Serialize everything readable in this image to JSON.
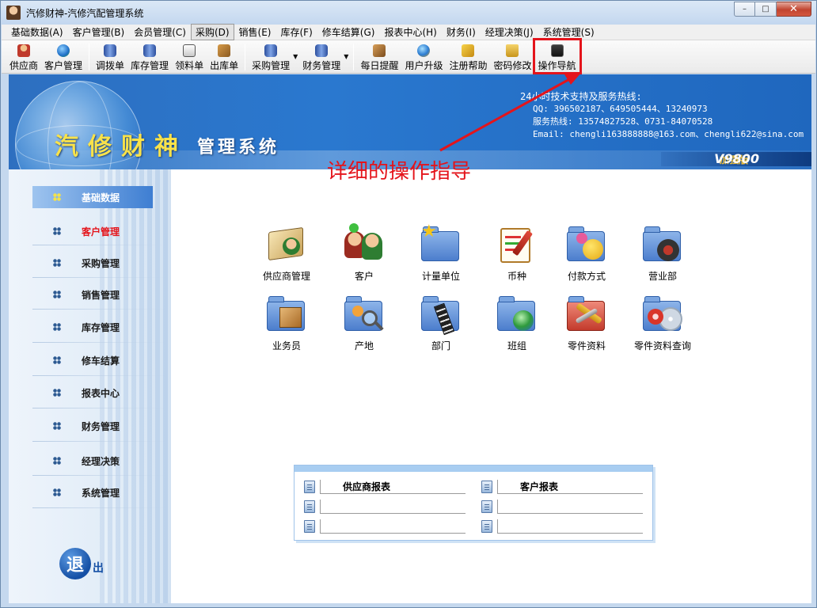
{
  "window": {
    "title": "汽修财神-汽修汽配管理系统",
    "controls": {
      "minimize": "–",
      "maximize": "□",
      "close": "✕"
    }
  },
  "menu": [
    {
      "label": "基础数据(A)"
    },
    {
      "label": "客户管理(B)"
    },
    {
      "label": "会员管理(C)"
    },
    {
      "label": "采购(D)"
    },
    {
      "label": "销售(E)"
    },
    {
      "label": "库存(F)"
    },
    {
      "label": "修车结算(G)"
    },
    {
      "label": "报表中心(H)"
    },
    {
      "label": "财务(I)"
    },
    {
      "label": "经理决策(J)"
    },
    {
      "label": "系统管理(S)"
    }
  ],
  "toolbar": {
    "supplier": "供应商",
    "customer_mgmt": "客户管理",
    "transfer": "调拨单",
    "inventory_mgmt": "库存管理",
    "material_req": "领料单",
    "outbound": "出库单",
    "purchase_mgmt": "采购管理",
    "finance_mgmt": "财务管理",
    "daily_reminder": "每日提醒",
    "user_upgrade": "用户升级",
    "register_help": "注册帮助",
    "password_change": "密码修改",
    "operation_guide": "操作导航"
  },
  "banner": {
    "title": "汽修财神",
    "subtitle": "管理系统",
    "support_heading": "24小时技术支持及服务热线:",
    "qq": "QQ: 396502187、649505444、13240973",
    "hotline": "服务热线: 13574827528、0731-84070528",
    "email": "Email: chengli163888888@163.com、chengli622@sina.com",
    "edition": "加强版",
    "version": "V9800"
  },
  "annotation": {
    "text": "详细的操作指导",
    "color": "#e4141b"
  },
  "leftnav": {
    "items": [
      {
        "label": "基础数据"
      },
      {
        "label": "客户管理"
      },
      {
        "label": "采购管理"
      },
      {
        "label": "销售管理"
      },
      {
        "label": "库存管理"
      },
      {
        "label": "修车结算"
      },
      {
        "label": "报表中心"
      },
      {
        "label": "财务管理"
      },
      {
        "label": "经理决策"
      },
      {
        "label": "系统管理"
      }
    ],
    "exit_char": "退",
    "exit_rest": "出"
  },
  "modules": [
    {
      "label": "供应商管理",
      "icon": "supplier-book-icon"
    },
    {
      "label": "客户",
      "icon": "customer-people-icon"
    },
    {
      "label": "计量单位",
      "icon": "unit-folder-star-icon"
    },
    {
      "label": "币种",
      "icon": "currency-clipboard-icon"
    },
    {
      "label": "付款方式",
      "icon": "payment-folder-icon"
    },
    {
      "label": "营业部",
      "icon": "branch-folder-headset-icon"
    },
    {
      "label": "业务员",
      "icon": "salesman-folder-box-icon"
    },
    {
      "label": "产地",
      "icon": "origin-folder-magnifier-icon"
    },
    {
      "label": "部门",
      "icon": "department-folder-film-icon"
    },
    {
      "label": "班组",
      "icon": "team-folder-globe-icon"
    },
    {
      "label": "零件资料",
      "icon": "parts-folder-wrench-icon"
    },
    {
      "label": "零件资料查询",
      "icon": "parts-query-folder-disc-icon"
    }
  ],
  "reports": {
    "supplier_report": "供应商报表",
    "customer_report": "客户报表"
  },
  "colors": {
    "accent_red": "#e4141b",
    "banner_blue": "#2a78cf",
    "brand_yellow": "#f9e24a"
  }
}
